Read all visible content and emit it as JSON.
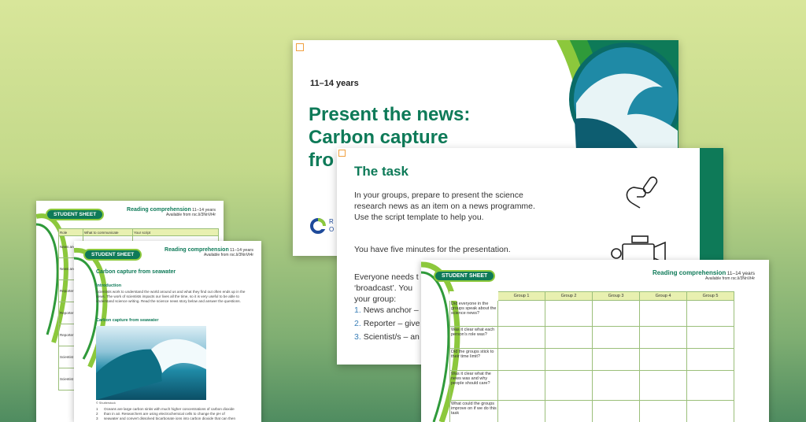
{
  "title_slide": {
    "age": "11–14 years",
    "title_line1": "Present the news:",
    "title_line2": "Carbon capture",
    "title_line3": "fro",
    "logo_text_1": "R",
    "logo_text_2": "O"
  },
  "task_slide": {
    "heading": "The task",
    "para1": "In your groups, prepare to present the science research news as an item on a news programme. Use the script template to help you.",
    "para2": "You have five minutes for the presentation.",
    "para3_line1": "Everyone needs t",
    "para3_line2": "‘broadcast’. You",
    "para3_line3": "your group:",
    "roles": [
      {
        "num": "1.",
        "text": "News anchor –"
      },
      {
        "num": "2.",
        "text": "Reporter – give"
      },
      {
        "num": "3.",
        "text": "Scientist/s – an"
      }
    ]
  },
  "sheet_back": {
    "badge": "STUDENT SHEET",
    "header": "Reading comprehension",
    "header_age": "11–14 years",
    "available": "Available from rsc.li/3NnVt4r",
    "columns": [
      "Role",
      "What to communicate",
      "Your script"
    ],
    "rows": [
      "News anchor",
      "News anchor",
      "Reporter",
      "Reporter",
      "Reporter",
      "Scientist",
      "Scientist"
    ]
  },
  "sheet_mid": {
    "badge": "STUDENT SHEET",
    "header": "Reading comprehension",
    "header_age": "11–14 years",
    "available": "Available from rsc.li/3NnVt4r",
    "title": "Carbon capture from seawater",
    "intro_heading": "Introduction",
    "intro_text": "Scientists work to understand the world around us and what they find out often ends up in the news. The work of scientists impacts our lives all the time, so it is very useful to be able to understand science writing. Read the science news story below and answer the questions.",
    "subheading": "Carbon capture from seawater",
    "credit": "© Shutterstock",
    "lines": [
      {
        "n": "1",
        "t": "Oceans are large carbon sinks with much higher concentrations of carbon dioxide"
      },
      {
        "n": "2",
        "t": "than in air. Researchers are using electrochemical cells to change the pH of"
      },
      {
        "n": "3",
        "t": "seawater and convert dissolved bicarbonate ions into carbon dioxide that can then"
      }
    ]
  },
  "sheet_front": {
    "badge": "STUDENT SHEET",
    "header": "Reading comprehension",
    "header_age": "11–14 years",
    "available": "Available from rsc.li/3NnVt4r",
    "columns": [
      "Group 1",
      "Group 2",
      "Group 3",
      "Group 4",
      "Group 5"
    ],
    "questions": [
      "Did everyone in the groups speak about the science news?",
      "Was it clear what each person’s role was?",
      "Did the groups stick to their time limit?",
      "Was it clear what the news was and why people should care?",
      "What could the groups improve on if we do this task"
    ]
  },
  "colors": {
    "brand_green": "#0e7a58",
    "lime": "#8cc83c",
    "wave_blue": "#1f8aa6"
  }
}
